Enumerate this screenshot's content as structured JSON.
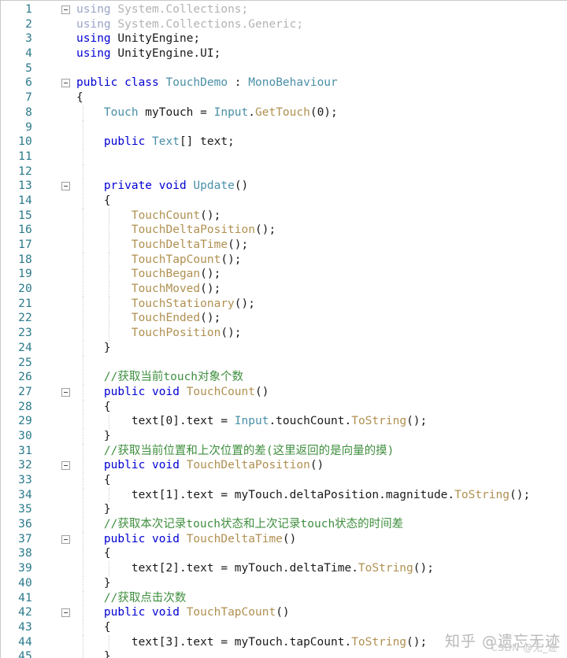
{
  "editor": {
    "language": "csharp",
    "file_kind": "code-listing",
    "first_line_number": 1,
    "last_line_number": 45,
    "colors": {
      "background": "#ffffff",
      "line_number": "#2b7a8c",
      "keyword": "#0000d4",
      "keyword_dimmed": "#9aa4c8",
      "type": "#4a8fa8",
      "type_dimmed": "#b3b3b3",
      "method": "#b09050",
      "plain": "#1a1a1a",
      "comment": "#3f8f3f",
      "indent_guide": "#cfcfcf",
      "fold_marker_border": "#a0a0a0"
    }
  },
  "lines": [
    {
      "n": "1",
      "fold": true,
      "guides": [],
      "tokens": [
        {
          "t": "using ",
          "c": "kw-dim"
        },
        {
          "t": "System.Collections;",
          "c": "type-dim"
        }
      ]
    },
    {
      "n": "2",
      "fold": false,
      "guides": [],
      "tokens": [
        {
          "t": "using ",
          "c": "kw-dim"
        },
        {
          "t": "System.Collections.Generic;",
          "c": "type-dim"
        }
      ]
    },
    {
      "n": "3",
      "fold": false,
      "guides": [],
      "tokens": [
        {
          "t": "using ",
          "c": "kw"
        },
        {
          "t": "UnityEngine;",
          "c": "plain"
        }
      ]
    },
    {
      "n": "4",
      "fold": false,
      "guides": [],
      "tokens": [
        {
          "t": "using ",
          "c": "kw"
        },
        {
          "t": "UnityEngine.UI;",
          "c": "plain"
        }
      ]
    },
    {
      "n": "5",
      "fold": false,
      "guides": [],
      "tokens": []
    },
    {
      "n": "6",
      "fold": true,
      "guides": [],
      "tokens": [
        {
          "t": "public class ",
          "c": "kw"
        },
        {
          "t": "TouchDemo",
          "c": "type"
        },
        {
          "t": " : ",
          "c": "plain"
        },
        {
          "t": "MonoBehaviour",
          "c": "type"
        }
      ]
    },
    {
      "n": "7",
      "fold": false,
      "guides": [],
      "tokens": [
        {
          "t": "{",
          "c": "plain"
        }
      ]
    },
    {
      "n": "8",
      "fold": false,
      "guides": [
        104
      ],
      "tokens": [
        {
          "t": "    ",
          "c": "plain"
        },
        {
          "t": "Touch",
          "c": "type"
        },
        {
          "t": " myTouch = ",
          "c": "plain"
        },
        {
          "t": "Input",
          "c": "type"
        },
        {
          "t": ".",
          "c": "plain"
        },
        {
          "t": "GetTouch",
          "c": "method"
        },
        {
          "t": "(0);",
          "c": "plain"
        }
      ]
    },
    {
      "n": "9",
      "fold": false,
      "guides": [
        104
      ],
      "tokens": []
    },
    {
      "n": "10",
      "fold": false,
      "guides": [
        104
      ],
      "tokens": [
        {
          "t": "    ",
          "c": "plain"
        },
        {
          "t": "public ",
          "c": "kw"
        },
        {
          "t": "Text",
          "c": "type"
        },
        {
          "t": "[] text;",
          "c": "plain"
        }
      ]
    },
    {
      "n": "11",
      "fold": false,
      "guides": [
        104
      ],
      "tokens": []
    },
    {
      "n": "12",
      "fold": false,
      "guides": [
        104
      ],
      "tokens": []
    },
    {
      "n": "13",
      "fold": true,
      "guides": [
        104
      ],
      "tokens": [
        {
          "t": "    ",
          "c": "plain"
        },
        {
          "t": "private void ",
          "c": "kw"
        },
        {
          "t": "Update",
          "c": "type"
        },
        {
          "t": "()",
          "c": "plain"
        }
      ]
    },
    {
      "n": "14",
      "fold": false,
      "guides": [
        104
      ],
      "tokens": [
        {
          "t": "    {",
          "c": "plain"
        }
      ]
    },
    {
      "n": "15",
      "fold": false,
      "guides": [
        104,
        137
      ],
      "tokens": [
        {
          "t": "        ",
          "c": "plain"
        },
        {
          "t": "TouchCount",
          "c": "method"
        },
        {
          "t": "();",
          "c": "plain"
        }
      ]
    },
    {
      "n": "16",
      "fold": false,
      "guides": [
        104,
        137
      ],
      "tokens": [
        {
          "t": "        ",
          "c": "plain"
        },
        {
          "t": "TouchDeltaPosition",
          "c": "method"
        },
        {
          "t": "();",
          "c": "plain"
        }
      ]
    },
    {
      "n": "17",
      "fold": false,
      "guides": [
        104,
        137
      ],
      "tokens": [
        {
          "t": "        ",
          "c": "plain"
        },
        {
          "t": "TouchDeltaTime",
          "c": "method"
        },
        {
          "t": "();",
          "c": "plain"
        }
      ]
    },
    {
      "n": "18",
      "fold": false,
      "guides": [
        104,
        137
      ],
      "tokens": [
        {
          "t": "        ",
          "c": "plain"
        },
        {
          "t": "TouchTapCount",
          "c": "method"
        },
        {
          "t": "();",
          "c": "plain"
        }
      ]
    },
    {
      "n": "19",
      "fold": false,
      "guides": [
        104,
        137
      ],
      "tokens": [
        {
          "t": "        ",
          "c": "plain"
        },
        {
          "t": "TouchBegan",
          "c": "method"
        },
        {
          "t": "();",
          "c": "plain"
        }
      ]
    },
    {
      "n": "20",
      "fold": false,
      "guides": [
        104,
        137
      ],
      "tokens": [
        {
          "t": "        ",
          "c": "plain"
        },
        {
          "t": "TouchMoved",
          "c": "method"
        },
        {
          "t": "();",
          "c": "plain"
        }
      ]
    },
    {
      "n": "21",
      "fold": false,
      "guides": [
        104,
        137
      ],
      "tokens": [
        {
          "t": "        ",
          "c": "plain"
        },
        {
          "t": "TouchStationary",
          "c": "method"
        },
        {
          "t": "();",
          "c": "plain"
        }
      ]
    },
    {
      "n": "22",
      "fold": false,
      "guides": [
        104,
        137
      ],
      "tokens": [
        {
          "t": "        ",
          "c": "plain"
        },
        {
          "t": "TouchEnded",
          "c": "method"
        },
        {
          "t": "();",
          "c": "plain"
        }
      ]
    },
    {
      "n": "23",
      "fold": false,
      "guides": [
        104,
        137
      ],
      "tokens": [
        {
          "t": "        ",
          "c": "plain"
        },
        {
          "t": "TouchPosition",
          "c": "method"
        },
        {
          "t": "();",
          "c": "plain"
        }
      ]
    },
    {
      "n": "24",
      "fold": false,
      "guides": [
        104
      ],
      "tokens": [
        {
          "t": "    }",
          "c": "plain"
        }
      ]
    },
    {
      "n": "25",
      "fold": false,
      "guides": [
        104
      ],
      "tokens": []
    },
    {
      "n": "26",
      "fold": false,
      "guides": [
        104
      ],
      "tokens": [
        {
          "t": "    //获取当前touch对象个数",
          "c": "comment"
        }
      ]
    },
    {
      "n": "27",
      "fold": true,
      "guides": [
        104
      ],
      "tokens": [
        {
          "t": "    ",
          "c": "plain"
        },
        {
          "t": "public void ",
          "c": "kw"
        },
        {
          "t": "TouchCount",
          "c": "method"
        },
        {
          "t": "()",
          "c": "plain"
        }
      ]
    },
    {
      "n": "28",
      "fold": false,
      "guides": [
        104
      ],
      "tokens": [
        {
          "t": "    {",
          "c": "plain"
        }
      ]
    },
    {
      "n": "29",
      "fold": false,
      "guides": [
        104,
        137
      ],
      "tokens": [
        {
          "t": "        text[0].text = ",
          "c": "plain"
        },
        {
          "t": "Input",
          "c": "type"
        },
        {
          "t": ".touchCount.",
          "c": "plain"
        },
        {
          "t": "ToString",
          "c": "method"
        },
        {
          "t": "();",
          "c": "plain"
        }
      ]
    },
    {
      "n": "30",
      "fold": false,
      "guides": [
        104
      ],
      "tokens": [
        {
          "t": "    }",
          "c": "plain"
        }
      ]
    },
    {
      "n": "31",
      "fold": false,
      "guides": [
        104
      ],
      "tokens": [
        {
          "t": "    //获取当前位置和上次位置的差(这里返回的是向量的摸)",
          "c": "comment"
        }
      ]
    },
    {
      "n": "32",
      "fold": true,
      "guides": [
        104
      ],
      "tokens": [
        {
          "t": "    ",
          "c": "plain"
        },
        {
          "t": "public void ",
          "c": "kw"
        },
        {
          "t": "TouchDeltaPosition",
          "c": "method"
        },
        {
          "t": "()",
          "c": "plain"
        }
      ]
    },
    {
      "n": "33",
      "fold": false,
      "guides": [
        104
      ],
      "tokens": [
        {
          "t": "    {",
          "c": "plain"
        }
      ]
    },
    {
      "n": "34",
      "fold": false,
      "guides": [
        104,
        137
      ],
      "tokens": [
        {
          "t": "        text[1].text = myTouch.deltaPosition.magnitude.",
          "c": "plain"
        },
        {
          "t": "ToString",
          "c": "method"
        },
        {
          "t": "();",
          "c": "plain"
        }
      ]
    },
    {
      "n": "35",
      "fold": false,
      "guides": [
        104
      ],
      "tokens": [
        {
          "t": "    }",
          "c": "plain"
        }
      ]
    },
    {
      "n": "36",
      "fold": false,
      "guides": [
        104
      ],
      "tokens": [
        {
          "t": "    //获取本次记录touch状态和上次记录touch状态的时间差",
          "c": "comment"
        }
      ]
    },
    {
      "n": "37",
      "fold": true,
      "guides": [
        104
      ],
      "tokens": [
        {
          "t": "    ",
          "c": "plain"
        },
        {
          "t": "public void ",
          "c": "kw"
        },
        {
          "t": "TouchDeltaTime",
          "c": "method"
        },
        {
          "t": "()",
          "c": "plain"
        }
      ]
    },
    {
      "n": "38",
      "fold": false,
      "guides": [
        104
      ],
      "tokens": [
        {
          "t": "    {",
          "c": "plain"
        }
      ]
    },
    {
      "n": "39",
      "fold": false,
      "guides": [
        104,
        137
      ],
      "tokens": [
        {
          "t": "        text[2].text = myTouch.deltaTime.",
          "c": "plain"
        },
        {
          "t": "ToString",
          "c": "method"
        },
        {
          "t": "();",
          "c": "plain"
        }
      ]
    },
    {
      "n": "40",
      "fold": false,
      "guides": [
        104
      ],
      "tokens": [
        {
          "t": "    }",
          "c": "plain"
        }
      ]
    },
    {
      "n": "41",
      "fold": false,
      "guides": [
        104
      ],
      "tokens": [
        {
          "t": "    //获取点击次数",
          "c": "comment"
        }
      ]
    },
    {
      "n": "42",
      "fold": true,
      "guides": [
        104
      ],
      "tokens": [
        {
          "t": "    ",
          "c": "plain"
        },
        {
          "t": "public void ",
          "c": "kw"
        },
        {
          "t": "TouchTapCount",
          "c": "method"
        },
        {
          "t": "()",
          "c": "plain"
        }
      ]
    },
    {
      "n": "43",
      "fold": false,
      "guides": [
        104
      ],
      "tokens": [
        {
          "t": "    {",
          "c": "plain"
        }
      ]
    },
    {
      "n": "44",
      "fold": false,
      "guides": [
        104,
        137
      ],
      "tokens": [
        {
          "t": "        text[3].text = myTouch.tapCount.",
          "c": "plain"
        },
        {
          "t": "ToString",
          "c": "method"
        },
        {
          "t": "();",
          "c": "plain"
        }
      ]
    },
    {
      "n": "45",
      "fold": false,
      "guides": [
        104
      ],
      "tokens": [
        {
          "t": "    }",
          "c": "plain"
        }
      ]
    }
  ],
  "watermark": {
    "zhihu": "知乎 @遗忘无迹",
    "csdn": "CSDN @无_迹"
  }
}
